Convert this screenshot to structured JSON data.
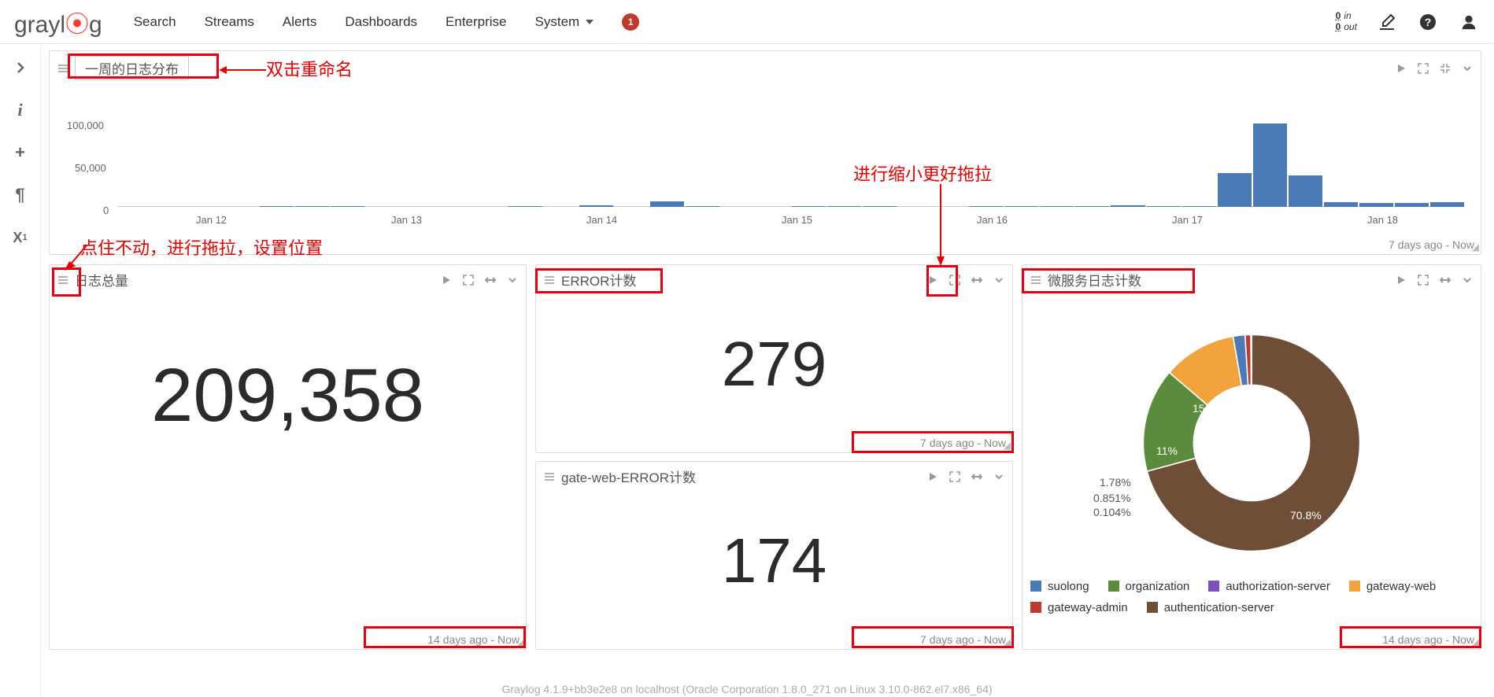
{
  "nav": {
    "brand": "graylog",
    "links": [
      "Search",
      "Streams",
      "Alerts",
      "Dashboards",
      "Enterprise",
      "System"
    ],
    "badge": "1",
    "throughput_in_value": "0",
    "throughput_in_unit": "in",
    "throughput_out_value": "0",
    "throughput_out_unit": "out"
  },
  "sidebar": {
    "items": [
      "chevron",
      "i",
      "plus",
      "paragraph",
      "x1"
    ]
  },
  "annotations": {
    "rename": "双击重命名",
    "drag_hint": "点住不动，进行拖拉，设置位置",
    "shrink_hint": "进行缩小更好拖拉"
  },
  "widget_week": {
    "title": "一周的日志分布",
    "footer": "7 days ago - Now",
    "yticks": [
      "100,000",
      "50,000",
      "0"
    ],
    "xticks": [
      "Jan 12",
      "Jan 13",
      "Jan 14",
      "Jan 15",
      "Jan 16",
      "Jan 17",
      "Jan 18"
    ]
  },
  "widget_total": {
    "title": "日志总量",
    "value": "209,358",
    "footer": "14 days ago - Now"
  },
  "widget_error": {
    "title": "ERROR计数",
    "value": "279",
    "footer": "7 days ago - Now"
  },
  "widget_gate": {
    "title": "gate-web-ERROR计数",
    "value": "174",
    "footer": "7 days ago - Now"
  },
  "widget_micro": {
    "title": "微服务日志计数",
    "footer": "14 days ago - Now",
    "legend": [
      "suolong",
      "organization",
      "authorization-server",
      "gateway-web",
      "gateway-admin",
      "authentication-server"
    ]
  },
  "chart_data": [
    {
      "type": "bar",
      "title": "一周的日志分布",
      "ylabel": "",
      "xlabel": "",
      "ylim": [
        0,
        110000
      ],
      "categories": [
        "Jan 12",
        "Jan 13",
        "Jan 14",
        "Jan 15",
        "Jan 16",
        "Jan 17",
        "Jan 18"
      ],
      "series": [
        {
          "name": "count",
          "values_by_bar": [
            0,
            0,
            0,
            0,
            500,
            500,
            800,
            0,
            0,
            0,
            0,
            500,
            0,
            1500,
            0,
            7000,
            500,
            0,
            0,
            500,
            500,
            500,
            0,
            0,
            500,
            500,
            500,
            500,
            1500,
            500,
            500,
            40000,
            100000,
            38000,
            5500,
            5000,
            5000,
            5500
          ]
        }
      ]
    },
    {
      "type": "pie",
      "title": "微服务日志计数",
      "series": [
        {
          "name": "authentication-server",
          "value": 70.8,
          "color": "#6f4e37"
        },
        {
          "name": "organization",
          "value": 15.5,
          "color": "#5b8c3e"
        },
        {
          "name": "gateway-web",
          "value": 11.0,
          "color": "#f2a33c"
        },
        {
          "name": "suolong",
          "value": 1.78,
          "color": "#4a7ab8"
        },
        {
          "name": "gateway-admin",
          "value": 0.851,
          "color": "#c0392b"
        },
        {
          "name": "authorization-server",
          "value": 0.104,
          "color": "#7a4fbf"
        }
      ],
      "labels": [
        "70.8%",
        "15.5%",
        "11%",
        "1.78%",
        "0.851%",
        "0.104%"
      ]
    }
  ],
  "footer": "Graylog 4.1.9+bb3e2e8 on localhost (Oracle Corporation 1.8.0_271 on Linux 3.10.0-862.el7.x86_64)"
}
